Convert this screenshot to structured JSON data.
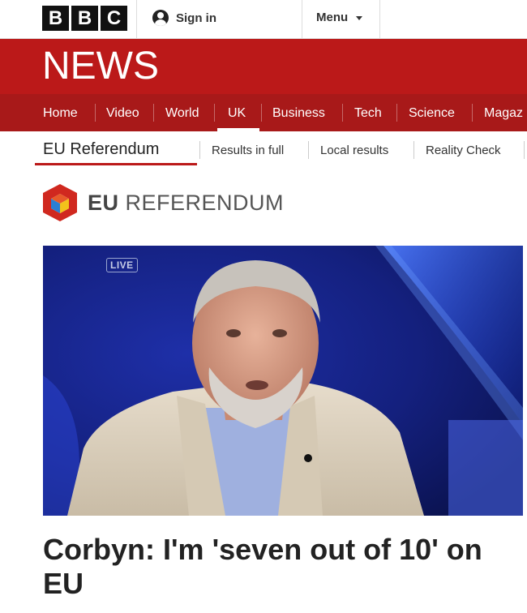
{
  "header": {
    "logo_letters": [
      "B",
      "B",
      "C"
    ],
    "signin_label": "Sign in",
    "menu_label": "Menu"
  },
  "news": {
    "title": "NEWS"
  },
  "nav": {
    "items": [
      "Home",
      "Video",
      "World",
      "UK",
      "Business",
      "Tech",
      "Science",
      "Magaz"
    ],
    "active": "UK"
  },
  "subnav": {
    "current": "EU Referendum",
    "links": [
      "Results in full",
      "Local results",
      "Reality Check"
    ]
  },
  "section": {
    "title_bold": "EU",
    "title_rest": " REFERENDUM"
  },
  "hero": {
    "badge": "LIVE"
  },
  "article": {
    "headline": "Corbyn: I'm 'seven out of 10' on EU"
  },
  "colors": {
    "bbc_red": "#bb1919",
    "nav_red": "#a81919",
    "logo_red": "#d0281f",
    "logo_blue": "#2a7fd4",
    "logo_yellow": "#f3c21b"
  }
}
